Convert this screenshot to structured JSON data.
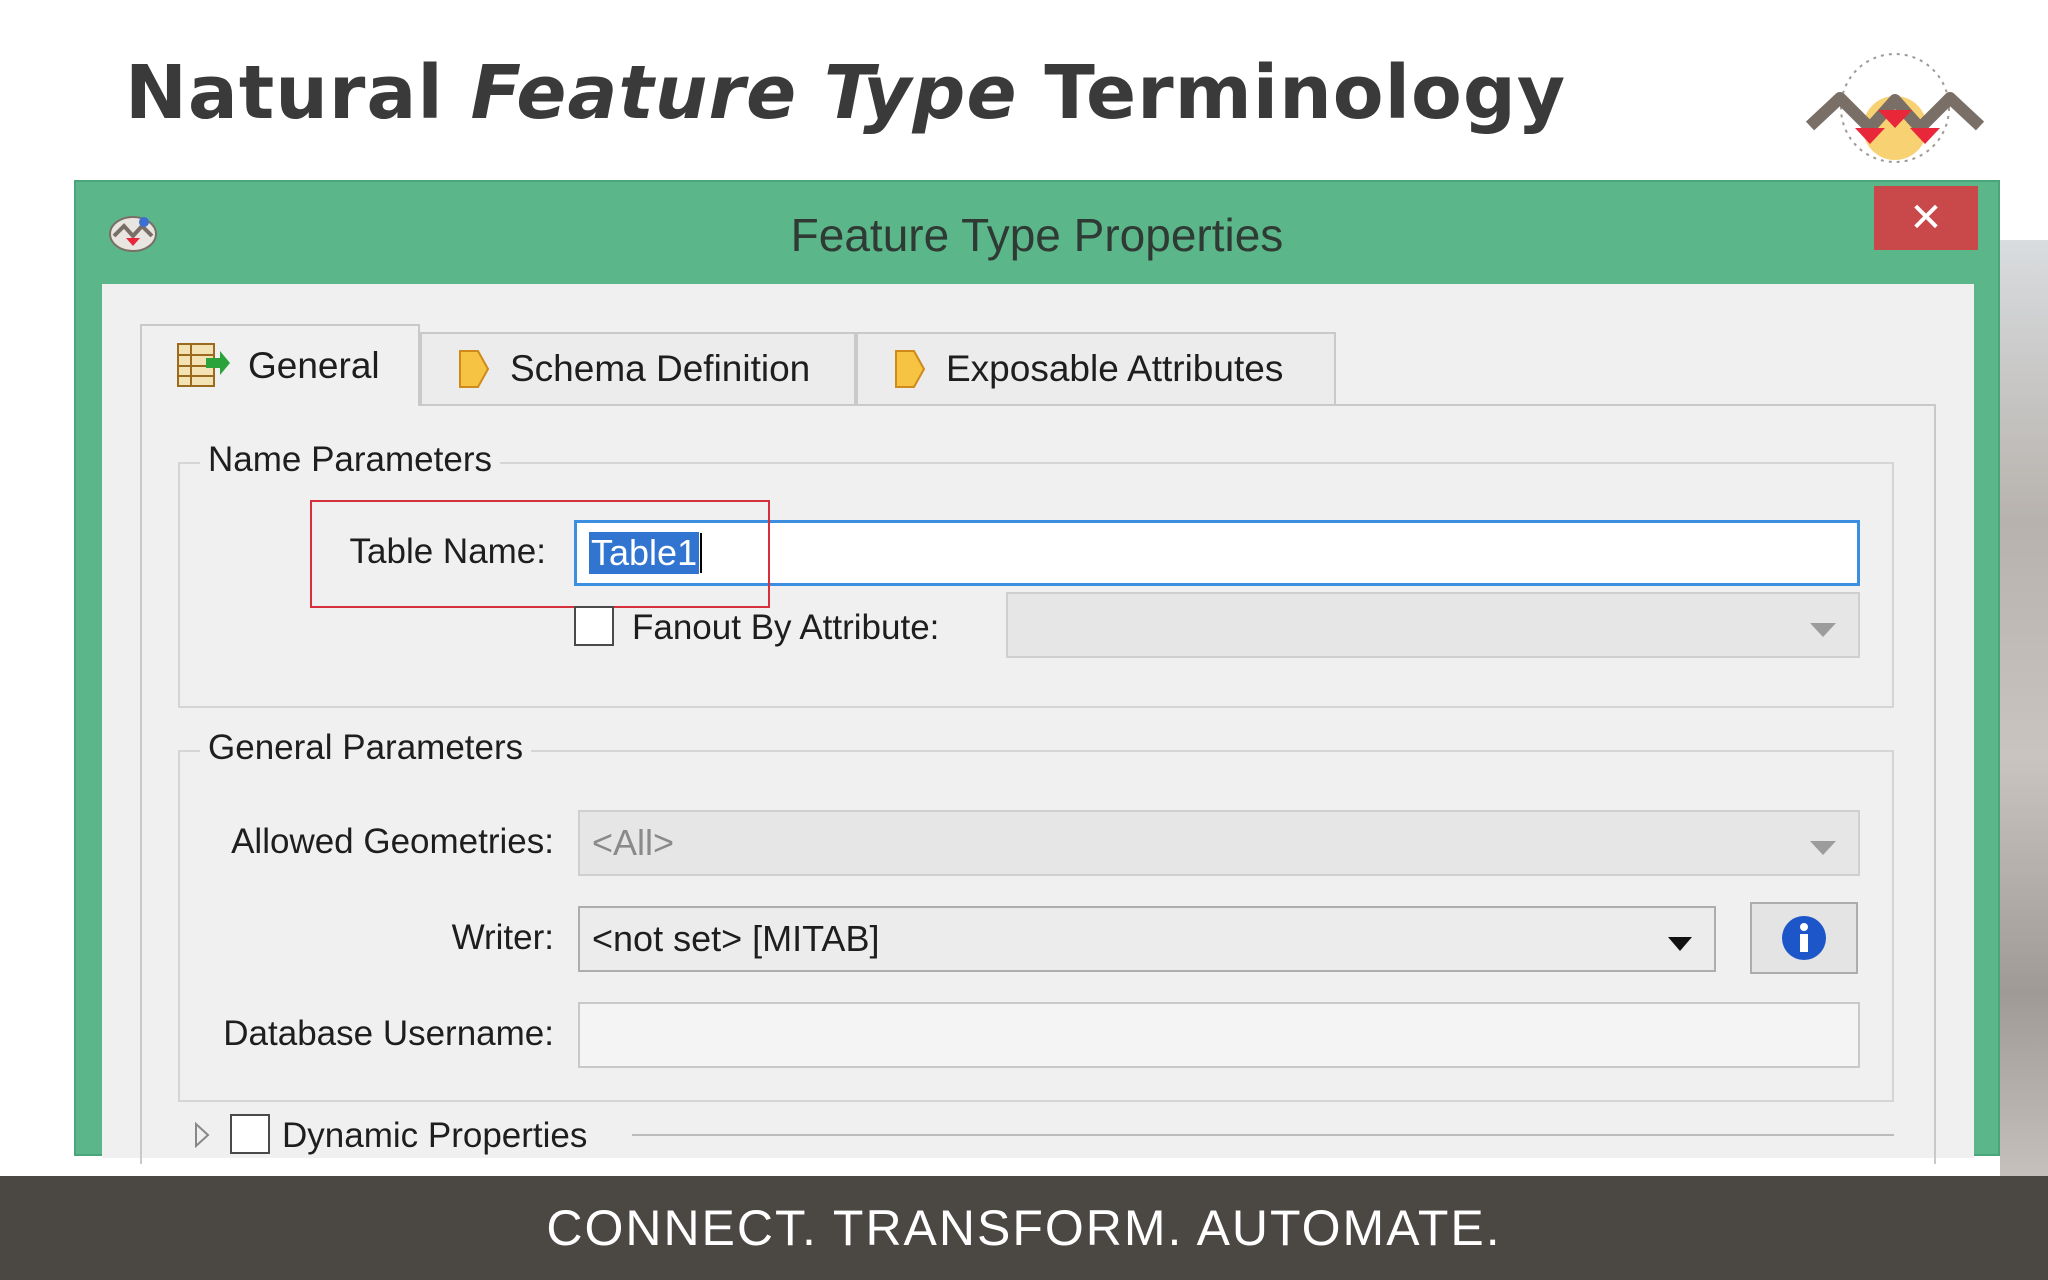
{
  "slide": {
    "title_plain": "Natural",
    "title_italic": "Feature Type",
    "title_end": "Terminology",
    "footer": "CONNECT. TRANSFORM. AUTOMATE."
  },
  "logo": {
    "text": "FME",
    "colors": [
      "#7a6f66",
      "#e8273a",
      "#f6c343"
    ]
  },
  "window": {
    "title": "Feature Type Properties",
    "close_label": "✕",
    "title_bar_color": "#5bb78a"
  },
  "tabs": [
    {
      "label": "General",
      "icon": "table-arrow-icon",
      "active": true
    },
    {
      "label": "Schema Definition",
      "icon": "tag-icon",
      "active": false
    },
    {
      "label": "Exposable Attributes",
      "icon": "tag-icon",
      "active": false
    }
  ],
  "name_parameters": {
    "group_label": "Name Parameters",
    "table_name_label": "Table Name:",
    "table_name_value": "Table1",
    "fanout_label": "Fanout By Attribute:",
    "fanout_checked": false,
    "fanout_value": ""
  },
  "general_parameters": {
    "group_label": "General Parameters",
    "allowed_geometries_label": "Allowed Geometries:",
    "allowed_geometries_value": "<All>",
    "writer_label": "Writer:",
    "writer_value": "<not set> [MITAB]",
    "db_username_label": "Database Username:",
    "db_username_value": ""
  },
  "dynamic_properties": {
    "label": "Dynamic Properties",
    "checked": false
  },
  "colors": {
    "highlight": "#d6303c",
    "focus": "#3c8fe0",
    "selection": "#3175d1",
    "info": "#1c56c9"
  }
}
